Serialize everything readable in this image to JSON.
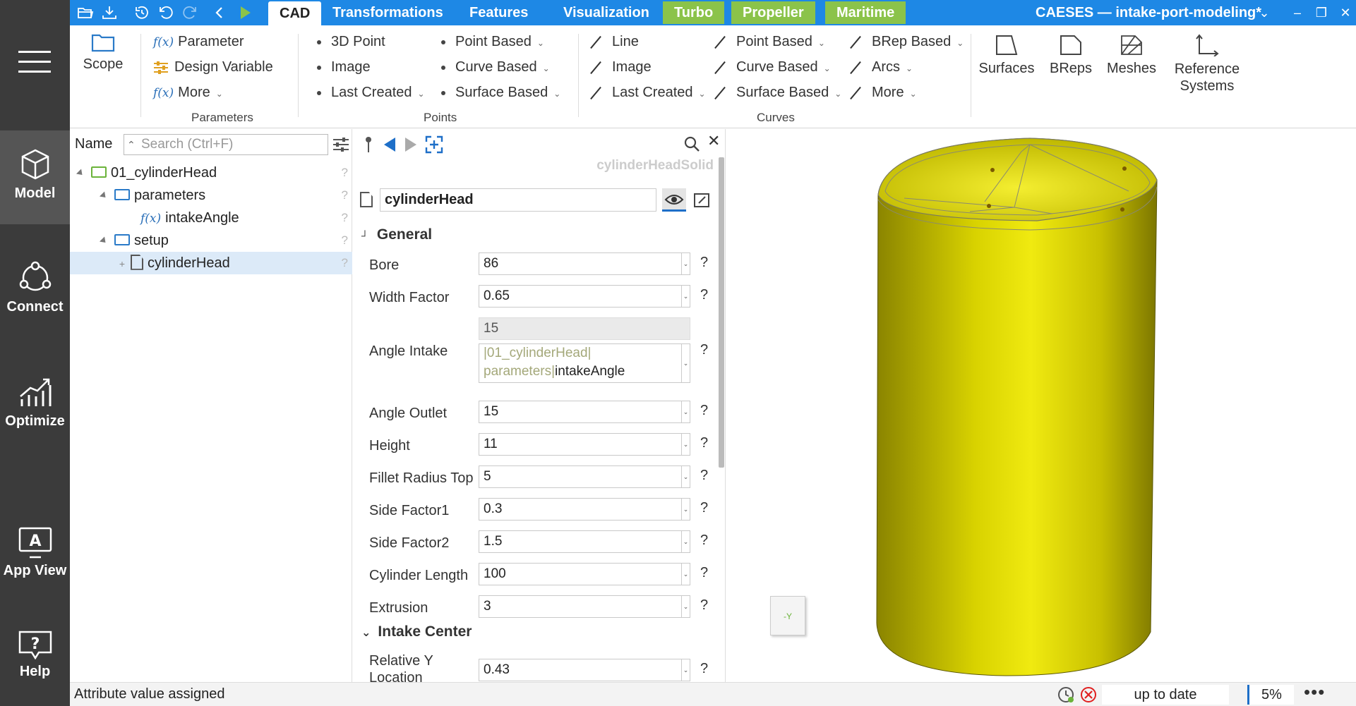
{
  "window": {
    "title": "CAESES — intake-port-modeling*",
    "tabs": [
      {
        "label": "CAD",
        "active": true
      },
      {
        "label": "Transformations"
      },
      {
        "label": "Features"
      },
      {
        "label": "Visualization"
      },
      {
        "label": "Turbo",
        "style": "green"
      },
      {
        "label": "Propeller",
        "style": "green"
      },
      {
        "label": "Maritime",
        "style": "green"
      }
    ]
  },
  "leftbar": {
    "items": [
      {
        "label": "Model",
        "icon": "cube-icon",
        "active": true
      },
      {
        "label": "Connect",
        "icon": "connect-icon"
      },
      {
        "label": "Optimize",
        "icon": "chart-icon"
      },
      {
        "label": "App View",
        "icon": "app-view-icon"
      },
      {
        "label": "Help",
        "icon": "help-icon"
      }
    ]
  },
  "ribbon": {
    "scope": "Scope",
    "parameters": {
      "items": [
        "Parameter",
        "Design Variable",
        "More"
      ],
      "group": "Parameters"
    },
    "points": {
      "col1": [
        "3D Point",
        "Image",
        "Last Created"
      ],
      "col2": [
        "Point Based",
        "Curve Based",
        "Surface Based"
      ],
      "group": "Points"
    },
    "curves": {
      "col1": [
        "Line",
        "Image",
        "Last Created"
      ],
      "col2": [
        "Point Based",
        "Curve Based",
        "Surface Based"
      ],
      "col3": [
        "BRep Based",
        "Arcs",
        "More"
      ],
      "group": "Curves"
    },
    "big": [
      "Surfaces",
      "BReps",
      "Meshes",
      "Reference Systems"
    ]
  },
  "tree": {
    "name_label": "Name",
    "search_placeholder": "Search (Ctrl+F)",
    "rows": [
      {
        "label": "01_cylinderHead",
        "level": 0
      },
      {
        "label": "parameters",
        "level": 1
      },
      {
        "label": "intakeAngle",
        "level": 2
      },
      {
        "label": "setup",
        "level": 1
      },
      {
        "label": "cylinderHead",
        "level": 2,
        "selected": true
      }
    ]
  },
  "props": {
    "ghost_title": "cylinderHeadSolid",
    "object_name": "cylinderHead",
    "section_general": "General",
    "section_intake": "Intake Center",
    "fields": [
      {
        "label": "Bore",
        "value": "86"
      },
      {
        "label": "Width Factor",
        "value": "0.65"
      },
      {
        "label": "Angle Intake",
        "value": "15",
        "expr1": "|01_cylinderHead|",
        "expr2a": "parameters|",
        "expr2b": "intakeAngle"
      },
      {
        "label": "Angle Outlet",
        "value": "15"
      },
      {
        "label": "Height",
        "value": "11"
      },
      {
        "label": "Fillet Radius Top",
        "value": "5"
      },
      {
        "label": "Side Factor1",
        "value": "0.3"
      },
      {
        "label": "Side Factor2",
        "value": "1.5"
      },
      {
        "label": "Cylinder Length",
        "value": "100"
      },
      {
        "label": "Extrusion",
        "value": "3"
      },
      {
        "label": "Relative Y Location",
        "value": "0.43"
      }
    ]
  },
  "viewport": {
    "cube_label": "-Y",
    "model_color": "#e0d800"
  },
  "status": {
    "message": "Attribute value assigned",
    "state": "up to date",
    "zoom": "5%"
  },
  "colors": {
    "accent": "#1e88e5",
    "green_tab": "#8bc34a",
    "sidebar": "#3b3b3b"
  }
}
